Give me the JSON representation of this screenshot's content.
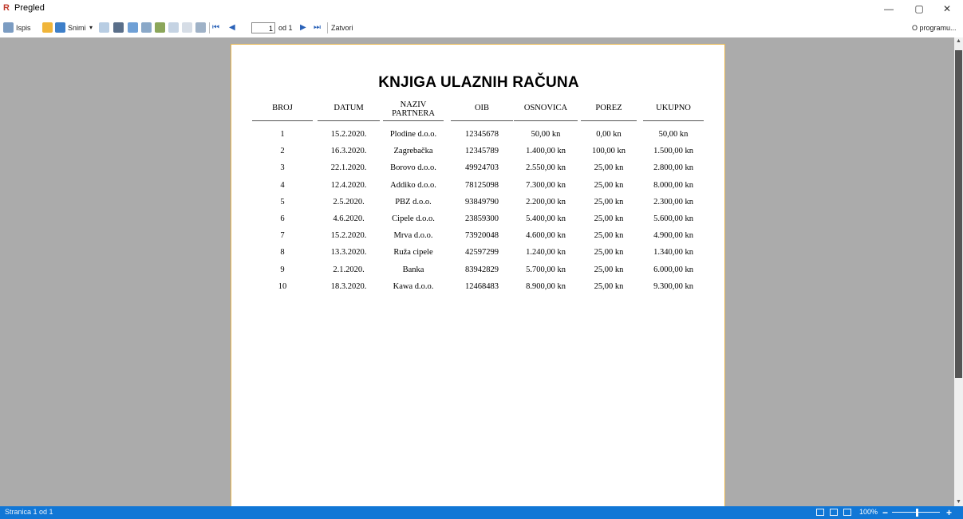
{
  "window": {
    "title": "Pregled",
    "minimize_symbol": "—",
    "maximize_symbol": "▢",
    "close_symbol": "✕"
  },
  "toolbar": {
    "print_label": "Ispis",
    "save_label": "Snimi",
    "page_current": "1",
    "page_of": "od 1",
    "close_label": "Zatvori",
    "about_label": "O programu..."
  },
  "report": {
    "title": "KNJIGA ULAZNIH RAČUNA",
    "columns": [
      "BROJ",
      "DATUM",
      "NAZIV PARTNERA",
      "OIB",
      "OSNOVICA",
      "POREZ",
      "UKUPNO"
    ],
    "rows": [
      [
        "1",
        "15.2.2020.",
        "Plodine d.o.o.",
        "12345678",
        "50,00 kn",
        "0,00 kn",
        "50,00 kn"
      ],
      [
        "2",
        "16.3.2020.",
        "Zagrebačka",
        "12345789",
        "1.400,00 kn",
        "100,00 kn",
        "1.500,00 kn"
      ],
      [
        "3",
        "22.1.2020.",
        "Borovo d.o.o.",
        "49924703",
        "2.550,00 kn",
        "25,00 kn",
        "2.800,00 kn"
      ],
      [
        "4",
        "12.4.2020.",
        "Addiko d.o.o.",
        "78125098",
        "7.300,00 kn",
        "25,00 kn",
        "8.000,00 kn"
      ],
      [
        "5",
        "2.5.2020.",
        "PBZ d.o.o.",
        "93849790",
        "2.200,00 kn",
        "25,00 kn",
        "2.300,00 kn"
      ],
      [
        "6",
        "4.6.2020.",
        "Cipele d.o.o.",
        "23859300",
        "5.400,00 kn",
        "25,00 kn",
        "5.600,00 kn"
      ],
      [
        "7",
        "15.2.2020.",
        "Mrva d.o.o.",
        "73920048",
        "4.600,00 kn",
        "25,00 kn",
        "4.900,00 kn"
      ],
      [
        "8",
        "13.3.2020.",
        "Ruža cipele",
        "42597299",
        "1.240,00 kn",
        "25,00 kn",
        "1.340,00 kn"
      ],
      [
        "9",
        "2.1.2020.",
        "Banka",
        "83942829",
        "5.700,00 kn",
        "25,00 kn",
        "6.000,00 kn"
      ],
      [
        "10",
        "18.3.2020.",
        "Kawa d.o.o.",
        "12468483",
        "8.900,00 kn",
        "25,00 kn",
        "9.300,00 kn"
      ]
    ]
  },
  "status": {
    "page_text": "Stranica 1 od 1",
    "zoom": "100%",
    "zoom_out_symbol": "−",
    "zoom_in_symbol": "+"
  },
  "colors": {
    "statusbar": "#1177d6",
    "viewer_bg": "#ababab",
    "page_border": "#e8b64c",
    "logo": "#c0392b"
  }
}
